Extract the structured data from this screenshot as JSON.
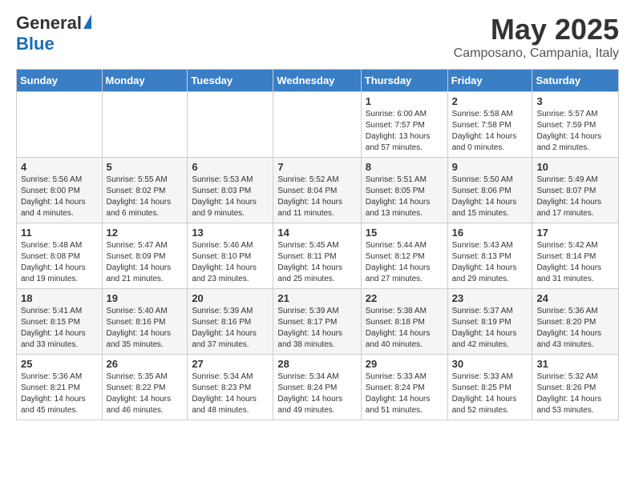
{
  "header": {
    "logo_general": "General",
    "logo_blue": "Blue",
    "title": "May 2025",
    "location": "Camposano, Campania, Italy"
  },
  "days_of_week": [
    "Sunday",
    "Monday",
    "Tuesday",
    "Wednesday",
    "Thursday",
    "Friday",
    "Saturday"
  ],
  "weeks": [
    [
      {
        "day": "",
        "info": ""
      },
      {
        "day": "",
        "info": ""
      },
      {
        "day": "",
        "info": ""
      },
      {
        "day": "",
        "info": ""
      },
      {
        "day": "1",
        "info": "Sunrise: 6:00 AM\nSunset: 7:57 PM\nDaylight: 13 hours\nand 57 minutes."
      },
      {
        "day": "2",
        "info": "Sunrise: 5:58 AM\nSunset: 7:58 PM\nDaylight: 14 hours\nand 0 minutes."
      },
      {
        "day": "3",
        "info": "Sunrise: 5:57 AM\nSunset: 7:59 PM\nDaylight: 14 hours\nand 2 minutes."
      }
    ],
    [
      {
        "day": "4",
        "info": "Sunrise: 5:56 AM\nSunset: 8:00 PM\nDaylight: 14 hours\nand 4 minutes."
      },
      {
        "day": "5",
        "info": "Sunrise: 5:55 AM\nSunset: 8:02 PM\nDaylight: 14 hours\nand 6 minutes."
      },
      {
        "day": "6",
        "info": "Sunrise: 5:53 AM\nSunset: 8:03 PM\nDaylight: 14 hours\nand 9 minutes."
      },
      {
        "day": "7",
        "info": "Sunrise: 5:52 AM\nSunset: 8:04 PM\nDaylight: 14 hours\nand 11 minutes."
      },
      {
        "day": "8",
        "info": "Sunrise: 5:51 AM\nSunset: 8:05 PM\nDaylight: 14 hours\nand 13 minutes."
      },
      {
        "day": "9",
        "info": "Sunrise: 5:50 AM\nSunset: 8:06 PM\nDaylight: 14 hours\nand 15 minutes."
      },
      {
        "day": "10",
        "info": "Sunrise: 5:49 AM\nSunset: 8:07 PM\nDaylight: 14 hours\nand 17 minutes."
      }
    ],
    [
      {
        "day": "11",
        "info": "Sunrise: 5:48 AM\nSunset: 8:08 PM\nDaylight: 14 hours\nand 19 minutes."
      },
      {
        "day": "12",
        "info": "Sunrise: 5:47 AM\nSunset: 8:09 PM\nDaylight: 14 hours\nand 21 minutes."
      },
      {
        "day": "13",
        "info": "Sunrise: 5:46 AM\nSunset: 8:10 PM\nDaylight: 14 hours\nand 23 minutes."
      },
      {
        "day": "14",
        "info": "Sunrise: 5:45 AM\nSunset: 8:11 PM\nDaylight: 14 hours\nand 25 minutes."
      },
      {
        "day": "15",
        "info": "Sunrise: 5:44 AM\nSunset: 8:12 PM\nDaylight: 14 hours\nand 27 minutes."
      },
      {
        "day": "16",
        "info": "Sunrise: 5:43 AM\nSunset: 8:13 PM\nDaylight: 14 hours\nand 29 minutes."
      },
      {
        "day": "17",
        "info": "Sunrise: 5:42 AM\nSunset: 8:14 PM\nDaylight: 14 hours\nand 31 minutes."
      }
    ],
    [
      {
        "day": "18",
        "info": "Sunrise: 5:41 AM\nSunset: 8:15 PM\nDaylight: 14 hours\nand 33 minutes."
      },
      {
        "day": "19",
        "info": "Sunrise: 5:40 AM\nSunset: 8:16 PM\nDaylight: 14 hours\nand 35 minutes."
      },
      {
        "day": "20",
        "info": "Sunrise: 5:39 AM\nSunset: 8:16 PM\nDaylight: 14 hours\nand 37 minutes."
      },
      {
        "day": "21",
        "info": "Sunrise: 5:39 AM\nSunset: 8:17 PM\nDaylight: 14 hours\nand 38 minutes."
      },
      {
        "day": "22",
        "info": "Sunrise: 5:38 AM\nSunset: 8:18 PM\nDaylight: 14 hours\nand 40 minutes."
      },
      {
        "day": "23",
        "info": "Sunrise: 5:37 AM\nSunset: 8:19 PM\nDaylight: 14 hours\nand 42 minutes."
      },
      {
        "day": "24",
        "info": "Sunrise: 5:36 AM\nSunset: 8:20 PM\nDaylight: 14 hours\nand 43 minutes."
      }
    ],
    [
      {
        "day": "25",
        "info": "Sunrise: 5:36 AM\nSunset: 8:21 PM\nDaylight: 14 hours\nand 45 minutes."
      },
      {
        "day": "26",
        "info": "Sunrise: 5:35 AM\nSunset: 8:22 PM\nDaylight: 14 hours\nand 46 minutes."
      },
      {
        "day": "27",
        "info": "Sunrise: 5:34 AM\nSunset: 8:23 PM\nDaylight: 14 hours\nand 48 minutes."
      },
      {
        "day": "28",
        "info": "Sunrise: 5:34 AM\nSunset: 8:24 PM\nDaylight: 14 hours\nand 49 minutes."
      },
      {
        "day": "29",
        "info": "Sunrise: 5:33 AM\nSunset: 8:24 PM\nDaylight: 14 hours\nand 51 minutes."
      },
      {
        "day": "30",
        "info": "Sunrise: 5:33 AM\nSunset: 8:25 PM\nDaylight: 14 hours\nand 52 minutes."
      },
      {
        "day": "31",
        "info": "Sunrise: 5:32 AM\nSunset: 8:26 PM\nDaylight: 14 hours\nand 53 minutes."
      }
    ]
  ]
}
